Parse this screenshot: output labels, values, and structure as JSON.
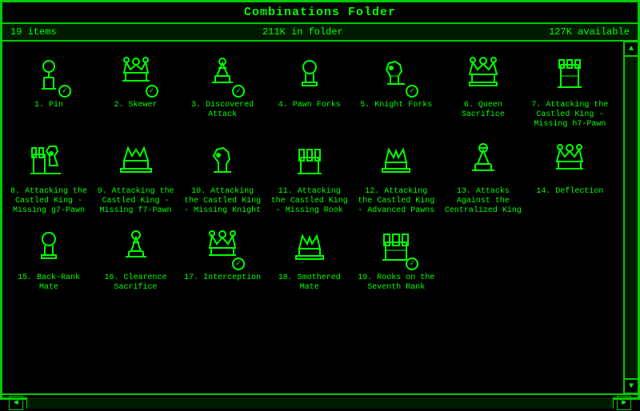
{
  "window": {
    "title": "Combinations Folder",
    "status": {
      "items_count": "19 items",
      "folder_size": "211K in folder",
      "available": "127K available"
    }
  },
  "items": [
    {
      "id": 1,
      "label": "1. Pin",
      "icon": "pin",
      "checked": true
    },
    {
      "id": 2,
      "label": "2. Skewer",
      "icon": "skewer",
      "checked": true
    },
    {
      "id": 3,
      "label": "3. Discovered Attack",
      "icon": "discovered",
      "checked": true
    },
    {
      "id": 4,
      "label": "4. Pawn Forks",
      "icon": "pawn",
      "checked": false
    },
    {
      "id": 5,
      "label": "5. Knight Forks",
      "icon": "knight",
      "checked": true
    },
    {
      "id": 6,
      "label": "6. Queen Sacrifice",
      "icon": "queen",
      "checked": false
    },
    {
      "id": 7,
      "label": "7. Attacking the Castled King - Missing h7-Pawn",
      "icon": "king",
      "checked": false
    },
    {
      "id": 8,
      "label": "8. Attacking the Castled King - Missing g7-Pawn",
      "icon": "castle-rook",
      "checked": false
    },
    {
      "id": 9,
      "label": "9. Attacking the Castled King - Missing f7-Pawn",
      "icon": "king2",
      "checked": false
    },
    {
      "id": 10,
      "label": "10. Attacking the Castled King - Missing Knight",
      "icon": "knight2",
      "checked": false
    },
    {
      "id": 11,
      "label": "11. Attacking the Castled King - Missing Rook",
      "icon": "rook2",
      "checked": false
    },
    {
      "id": 12,
      "label": "12. Attacking the Castled King - Advanced Pawns",
      "icon": "king3",
      "checked": false
    },
    {
      "id": 13,
      "label": "13. Attacks Against the Centralized King",
      "icon": "bishop",
      "checked": false
    },
    {
      "id": 14,
      "label": "14. Deflection",
      "icon": "queen2",
      "checked": false
    },
    {
      "id": 15,
      "label": "15. Back-Rank Mate",
      "icon": "pawn2",
      "checked": false
    },
    {
      "id": 16,
      "label": "16. Clearence Sacrifice",
      "icon": "bishop2",
      "checked": false
    },
    {
      "id": 17,
      "label": "17. Interception",
      "icon": "queen3",
      "checked": true
    },
    {
      "id": 18,
      "label": "18. Smothered Mate",
      "icon": "king4",
      "checked": false
    },
    {
      "id": 19,
      "label": "19. Rooks on the Seventh Rank",
      "icon": "rook3",
      "checked": true
    }
  ],
  "scrollbar": {
    "up_arrow": "▲",
    "down_arrow": "▼",
    "left_arrow": "◄",
    "right_arrow": "►"
  }
}
